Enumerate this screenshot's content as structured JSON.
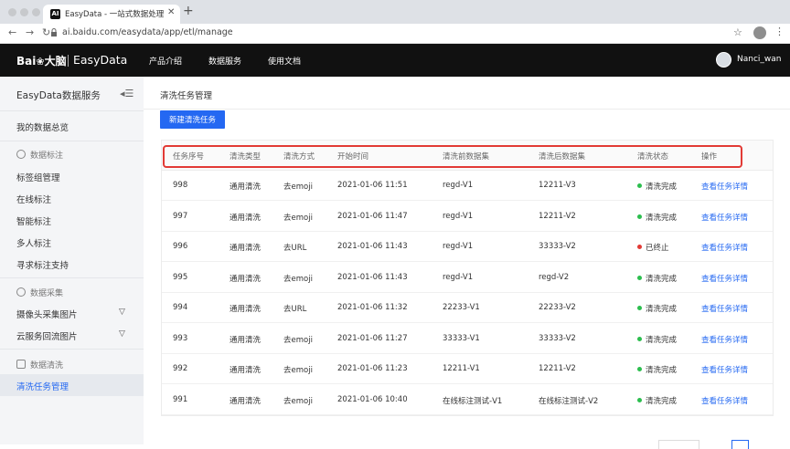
{
  "browser": {
    "tab_title": "EasyData - 一站式数据处理和服务",
    "favicon_text": "AI",
    "url": "ai.baidu.com/easydata/app/etl/manage"
  },
  "topnav": {
    "logo_text": "Bai",
    "logo_paw": "❀",
    "logo_brand_cn": "大脑",
    "product": "EasyData",
    "links": [
      "产品介绍",
      "数据服务",
      "使用文档"
    ],
    "username": "Nanci_wan"
  },
  "sidebar": {
    "title": "EasyData数据服务",
    "overview": "我的数据总览",
    "group_annotation": "数据标注",
    "annotation_items": [
      "标签组管理",
      "在线标注",
      "智能标注",
      "多人标注",
      "寻求标注支持"
    ],
    "group_collection": "数据采集",
    "collection_items": [
      "摄像头采集图片",
      "云服务回流图片"
    ],
    "group_cleaning": "数据清洗",
    "active_item": "清洗任务管理"
  },
  "page": {
    "title": "清洗任务管理",
    "new_button": "新建清洗任务"
  },
  "table": {
    "columns": [
      "任务序号",
      "清洗类型",
      "清洗方式",
      "开始时间",
      "清洗前数据集",
      "清洗后数据集",
      "清洗状态",
      "操作"
    ],
    "rows": [
      {
        "id": "998",
        "type": "通用清洗",
        "method": "去emoji",
        "start": "2021-01-06 11:51",
        "before": "regd-V1",
        "after": "12211-V3",
        "status": "清洗完成",
        "action": "查看任务详情"
      },
      {
        "id": "997",
        "type": "通用清洗",
        "method": "去emoji",
        "start": "2021-01-06 11:47",
        "before": "regd-V1",
        "after": "12211-V2",
        "status": "清洗完成",
        "action": "查看任务详情"
      },
      {
        "id": "996",
        "type": "通用清洗",
        "method": "去URL",
        "start": "2021-01-06 11:43",
        "before": "regd-V1",
        "after": "33333-V2",
        "status": "已终止",
        "action": "查看任务详情"
      },
      {
        "id": "995",
        "type": "通用清洗",
        "method": "去emoji",
        "start": "2021-01-06 11:43",
        "before": "regd-V1",
        "after": "regd-V2",
        "status": "清洗完成",
        "action": "查看任务详情"
      },
      {
        "id": "994",
        "type": "通用清洗",
        "method": "去URL",
        "start": "2021-01-06 11:32",
        "before": "22233-V1",
        "after": "22233-V2",
        "status": "清洗完成",
        "action": "查看任务详情"
      },
      {
        "id": "993",
        "type": "通用清洗",
        "method": "去emoji",
        "start": "2021-01-06 11:27",
        "before": "33333-V1",
        "after": "33333-V2",
        "status": "清洗完成",
        "action": "查看任务详情"
      },
      {
        "id": "992",
        "type": "通用清洗",
        "method": "去emoji",
        "start": "2021-01-06 11:23",
        "before": "12211-V1",
        "after": "12211-V2",
        "status": "清洗完成",
        "action": "查看任务详情"
      },
      {
        "id": "991",
        "type": "通用清洗",
        "method": "去emoji",
        "start": "2021-01-06 10:40",
        "before": "在线标注测试-V1",
        "after": "在线标注测试-V2",
        "status": "清洗完成",
        "action": "查看任务详情"
      }
    ]
  },
  "colors": {
    "accent": "#2468f2",
    "status_done": "#2cbe4e",
    "status_stopped": "#e23a35",
    "highlight_box": "#e23a35"
  }
}
